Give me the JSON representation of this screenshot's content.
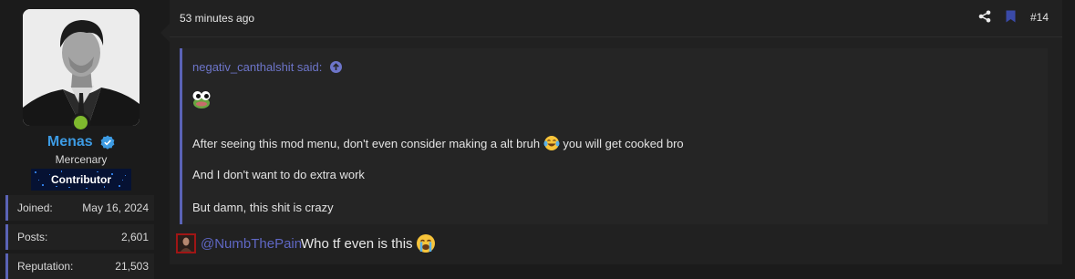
{
  "user": {
    "name": "Menas",
    "title": "Mercenary",
    "banner": "Contributor",
    "stats": [
      {
        "label": "Joined:",
        "value": "May 16, 2024"
      },
      {
        "label": "Posts:",
        "value": "2,601"
      },
      {
        "label": "Reputation:",
        "value": "21,503"
      }
    ]
  },
  "post": {
    "time": "53 minutes ago",
    "number": "#14",
    "quote": {
      "author": "negativ_canthalshit said:",
      "line1": "After seeing this mod menu, don't even consider making a alt bruh",
      "line1_after": "you will get cooked bro",
      "line2": "And I don't want to do extra work",
      "line3": "But damn, this shit is crazy"
    },
    "reply": {
      "mention": "@NumbThePain",
      "text": "Who tf even is this"
    }
  },
  "icons": {
    "share": "share-icon",
    "bookmark": "bookmark-icon",
    "verified": "verified-badge-icon",
    "jump": "arrow-up-circle-icon"
  },
  "colors": {
    "accent": "#5a63b6",
    "username": "#3d9be3",
    "online": "#7fba2e",
    "mention": "#5f67c4"
  }
}
